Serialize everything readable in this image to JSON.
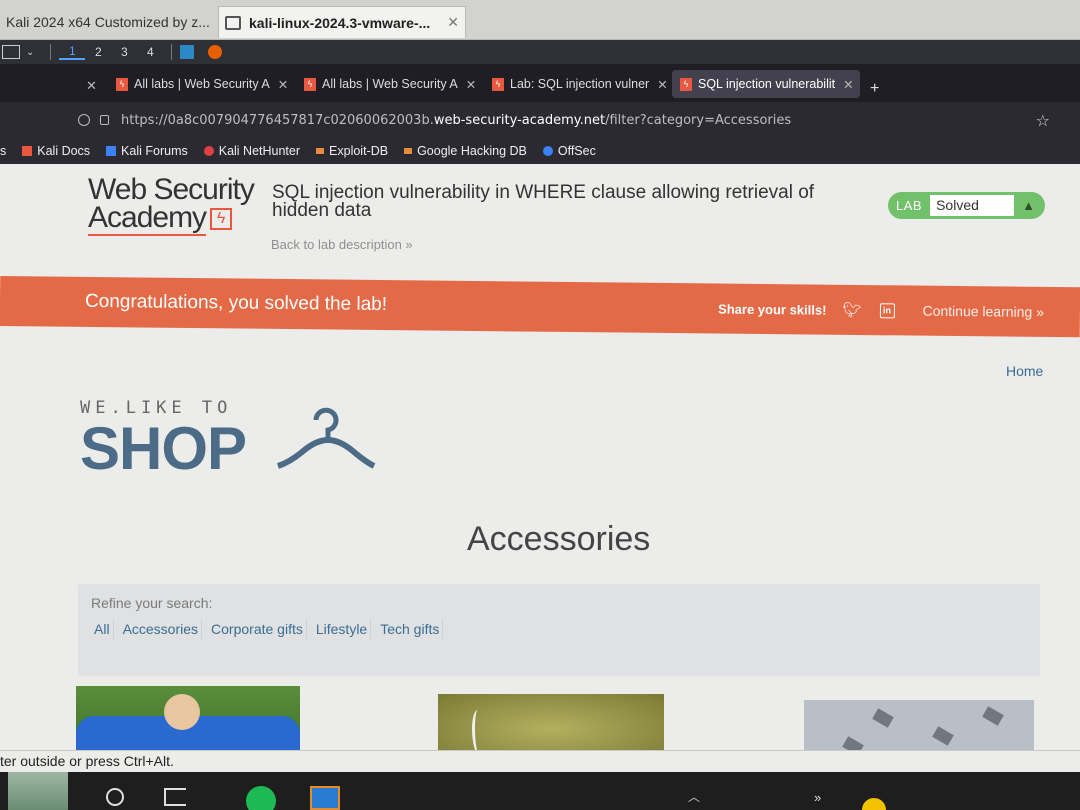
{
  "vm": {
    "tabs": [
      {
        "label": "Kali 2024 x64 Customized by z...",
        "close": "✕"
      },
      {
        "label": "kali-linux-2024.3-vmware-...",
        "close": "✕"
      }
    ],
    "status": "ter outside or press Ctrl+Alt."
  },
  "kali_panel": {
    "workspaces": [
      "1",
      "2",
      "3",
      "4"
    ]
  },
  "browser": {
    "tabs": [
      {
        "label": "All labs | Web Security A",
        "close": "✕"
      },
      {
        "label": "All labs | Web Security A",
        "close": "✕"
      },
      {
        "label": "Lab: SQL injection vulner",
        "close": "✕"
      },
      {
        "label": "SQL injection vulnerabilit",
        "close": "✕"
      }
    ],
    "close_lone": "✕",
    "new_tab": "+",
    "url_prefix": "https://0a8c007904776457817c02060062003b.",
    "url_host": "web-security-academy.net",
    "url_path": "/filter?category=Accessories",
    "bookmarks": [
      {
        "label": "s"
      },
      {
        "label": "Kali Docs"
      },
      {
        "label": "Kali Forums"
      },
      {
        "label": "Kali NetHunter"
      },
      {
        "label": "Exploit-DB"
      },
      {
        "label": "Google Hacking DB"
      },
      {
        "label": "OffSec"
      }
    ]
  },
  "page": {
    "logo_line1": "Web Security",
    "logo_line2": "Academy",
    "lab_title": "SQL injection vulnerability in WHERE clause allowing retrieval of hidden data",
    "back_link": "Back to lab description »",
    "badge_lab": "LAB",
    "badge_status": "Solved",
    "congrats": "Congratulations, you solved the lab!",
    "share": "Share your skills!",
    "continue": "Continue learning »",
    "home": "Home",
    "shop_tagline": "WE.LIKE TO",
    "shop_word": "SHOP",
    "category_title": "Accessories",
    "refine_label": "Refine your search:",
    "filters": [
      "All",
      "Accessories",
      "Corporate gifts",
      "Lifestyle",
      "Tech gifts"
    ]
  },
  "colors": {
    "accent": "#e46a47",
    "lab_green": "#70c16a",
    "link_blue": "#3a6e92",
    "shop_blue": "#4b6b86"
  }
}
